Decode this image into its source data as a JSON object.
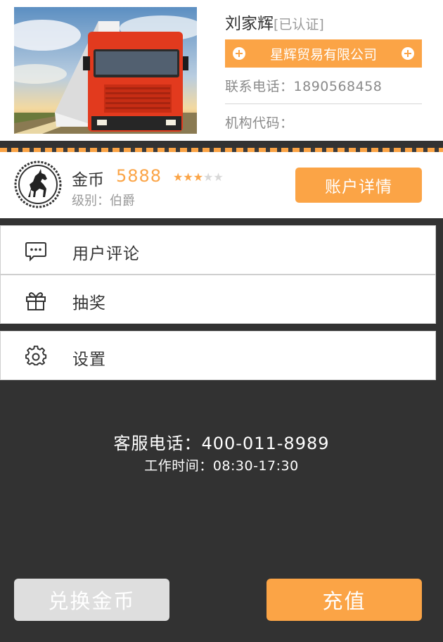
{
  "profile": {
    "name": "刘家辉",
    "verified": "[已认证]",
    "company": "星辉贸易有限公司",
    "phone_label": "联系电话：",
    "phone": "1890568458",
    "org_label": "机构代码：",
    "org_code": ""
  },
  "coins": {
    "label": "金币",
    "value": "5888",
    "rating": 3,
    "rating_max": 5,
    "level_label": "级别：",
    "level": "伯爵",
    "details_button": "账户详情"
  },
  "menu": [
    {
      "label": "用户评论",
      "icon": "chat-bubble-icon"
    },
    {
      "label": "抽奖",
      "icon": "gift-icon"
    },
    {
      "label": "设置",
      "icon": "gear-icon"
    }
  ],
  "service": {
    "phone_label": "客服电话：",
    "phone": "400-011-8989",
    "hours_label": "工作时间：",
    "hours": "08:30-17:30"
  },
  "buttons": {
    "exchange": "兑换金币",
    "recharge": "充值"
  },
  "colors": {
    "accent": "#fba446",
    "background": "#323232",
    "disabled": "#dedede"
  }
}
